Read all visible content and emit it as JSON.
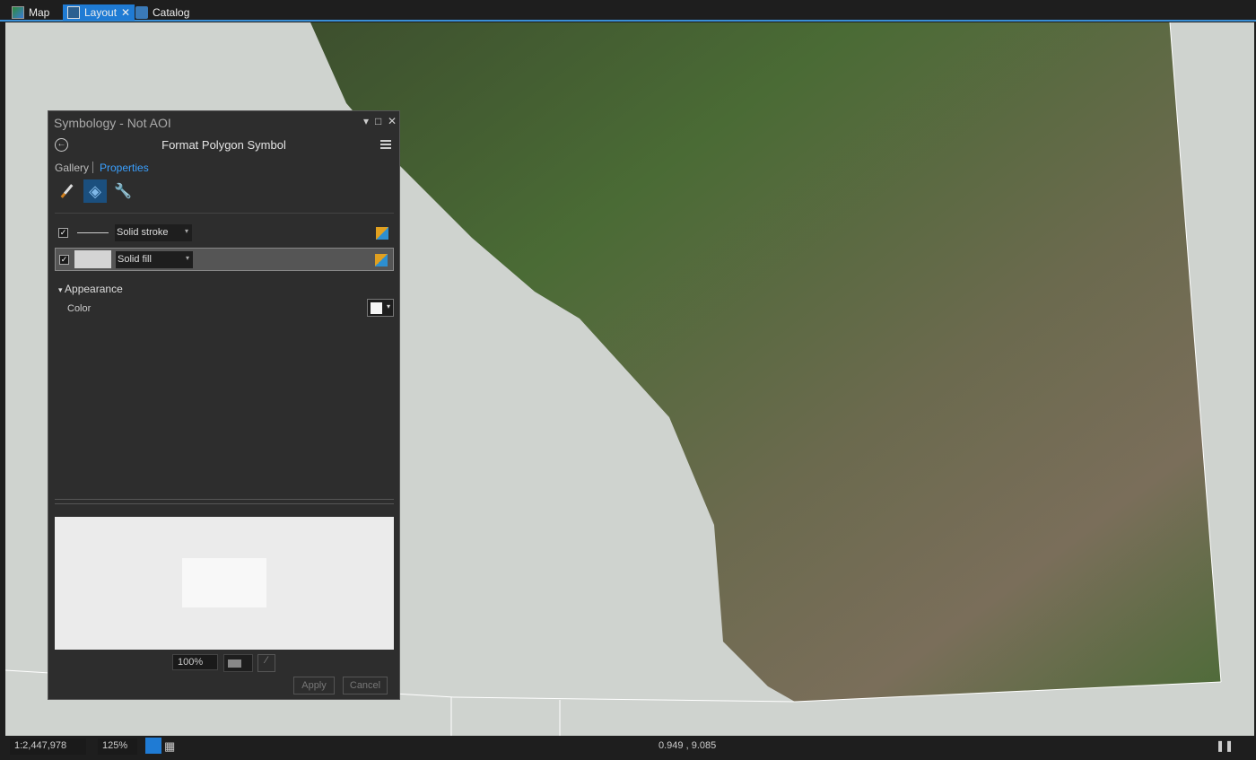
{
  "tabs": [
    {
      "label": "Map"
    },
    {
      "label": "Layout"
    },
    {
      "label": "Catalog"
    }
  ],
  "panel": {
    "title": "Symbology - Not AOI",
    "header": "Format Polygon Symbol",
    "gallery": "Gallery",
    "properties": "Properties",
    "layers": [
      {
        "label": "Solid stroke",
        "checked": true
      },
      {
        "label": "Solid fill",
        "checked": true
      }
    ],
    "section": "Appearance",
    "color_label": "Color",
    "zoom": "100%",
    "apply": "Apply",
    "cancel": "Cancel",
    "accent": "#3aa0ff"
  },
  "status": {
    "scale": "1:2,447,978",
    "zoom": "125%",
    "coords": "0.949 , 9.085"
  }
}
